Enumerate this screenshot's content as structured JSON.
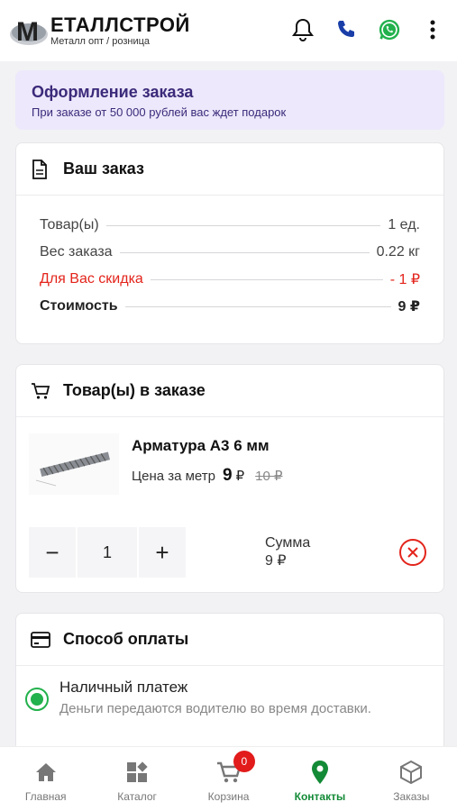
{
  "header": {
    "logo_letter": "M",
    "logo_title": "ЕТАЛЛСТРОЙ",
    "logo_subtitle": "Металл опт / розница",
    "icons": [
      "bell-icon",
      "phone-icon",
      "whatsapp-icon",
      "more-vertical-icon"
    ]
  },
  "promo": {
    "title": "Оформление заказа",
    "subtitle": "При заказе от 50 000 рублей вас ждет подарок"
  },
  "order_summary": {
    "title": "Ваш заказ",
    "rows": [
      {
        "label": "Товар(ы)",
        "value": "1 ед."
      },
      {
        "label": "Вес заказа",
        "value": "0.22 кг"
      },
      {
        "label": "Для Вас скидка",
        "value": "- 1 ₽"
      },
      {
        "label": "Стоимость",
        "value": "9 ₽"
      }
    ]
  },
  "items": {
    "title": "Товар(ы) в заказе",
    "item": {
      "name": "Арматура А3 6 мм",
      "price_label": "Цена за метр",
      "price_now": "9",
      "currency": "₽",
      "price_old": "10 ₽",
      "quantity": "1",
      "sum_label": "Сумма",
      "sum_value": "9 ₽",
      "minus": "−",
      "plus": "+"
    }
  },
  "payment": {
    "title": "Способ оплаты",
    "option_title": "Наличный платеж",
    "option_desc": "Деньги передаются водителю во время доставки."
  },
  "nav": {
    "items": [
      {
        "label": "Главная",
        "icon": "home-icon"
      },
      {
        "label": "Каталог",
        "icon": "catalog-icon"
      },
      {
        "label": "Корзина",
        "icon": "cart-icon",
        "badge": "0"
      },
      {
        "label": "Контакты",
        "icon": "location-pin-icon",
        "active": true
      },
      {
        "label": "Заказы",
        "icon": "box-icon"
      }
    ]
  },
  "colors": {
    "accent_green": "#22b14c",
    "discount_red": "#e3241b",
    "promo_bg": "#ede8fb",
    "promo_text": "#3b2a7a"
  }
}
